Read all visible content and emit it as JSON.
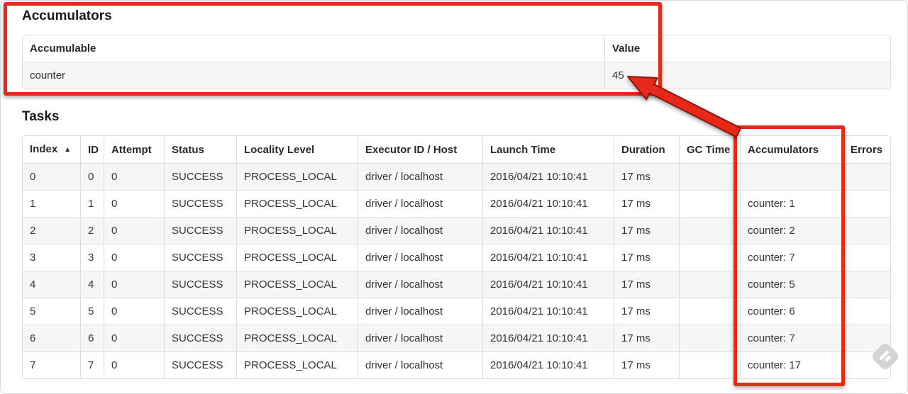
{
  "accumulators_section": {
    "title": "Accumulators",
    "table": {
      "headers": [
        "Accumulable",
        "Value"
      ],
      "rows": [
        [
          "counter",
          "45"
        ]
      ]
    }
  },
  "tasks_section": {
    "title": "Tasks",
    "table": {
      "headers": [
        "Index",
        "ID",
        "Attempt",
        "Status",
        "Locality Level",
        "Executor ID / Host",
        "Launch Time",
        "Duration",
        "GC Time",
        "Accumulators",
        "Errors"
      ],
      "sorted": {
        "column": 0,
        "indicator": "▲"
      },
      "rows": [
        [
          "0",
          "0",
          "0",
          "SUCCESS",
          "PROCESS_LOCAL",
          "driver / localhost",
          "2016/04/21 10:10:41",
          "17 ms",
          "",
          "",
          ""
        ],
        [
          "1",
          "1",
          "0",
          "SUCCESS",
          "PROCESS_LOCAL",
          "driver / localhost",
          "2016/04/21 10:10:41",
          "17 ms",
          "",
          "counter: 1",
          ""
        ],
        [
          "2",
          "2",
          "0",
          "SUCCESS",
          "PROCESS_LOCAL",
          "driver / localhost",
          "2016/04/21 10:10:41",
          "17 ms",
          "",
          "counter: 2",
          ""
        ],
        [
          "3",
          "3",
          "0",
          "SUCCESS",
          "PROCESS_LOCAL",
          "driver / localhost",
          "2016/04/21 10:10:41",
          "17 ms",
          "",
          "counter: 7",
          ""
        ],
        [
          "4",
          "4",
          "0",
          "SUCCESS",
          "PROCESS_LOCAL",
          "driver / localhost",
          "2016/04/21 10:10:41",
          "17 ms",
          "",
          "counter: 5",
          ""
        ],
        [
          "5",
          "5",
          "0",
          "SUCCESS",
          "PROCESS_LOCAL",
          "driver / localhost",
          "2016/04/21 10:10:41",
          "17 ms",
          "",
          "counter: 6",
          ""
        ],
        [
          "6",
          "6",
          "0",
          "SUCCESS",
          "PROCESS_LOCAL",
          "driver / localhost",
          "2016/04/21 10:10:41",
          "17 ms",
          "",
          "counter: 7",
          ""
        ],
        [
          "7",
          "7",
          "0",
          "SUCCESS",
          "PROCESS_LOCAL",
          "driver / localhost",
          "2016/04/21 10:10:41",
          "17 ms",
          "",
          "counter: 17",
          ""
        ]
      ]
    }
  },
  "annotation": {
    "color": "#e8281a",
    "outline_color": "#8f1408"
  },
  "icons": {
    "sort": "sort-ascending-icon",
    "watermark": "skitch-watermark-icon"
  }
}
